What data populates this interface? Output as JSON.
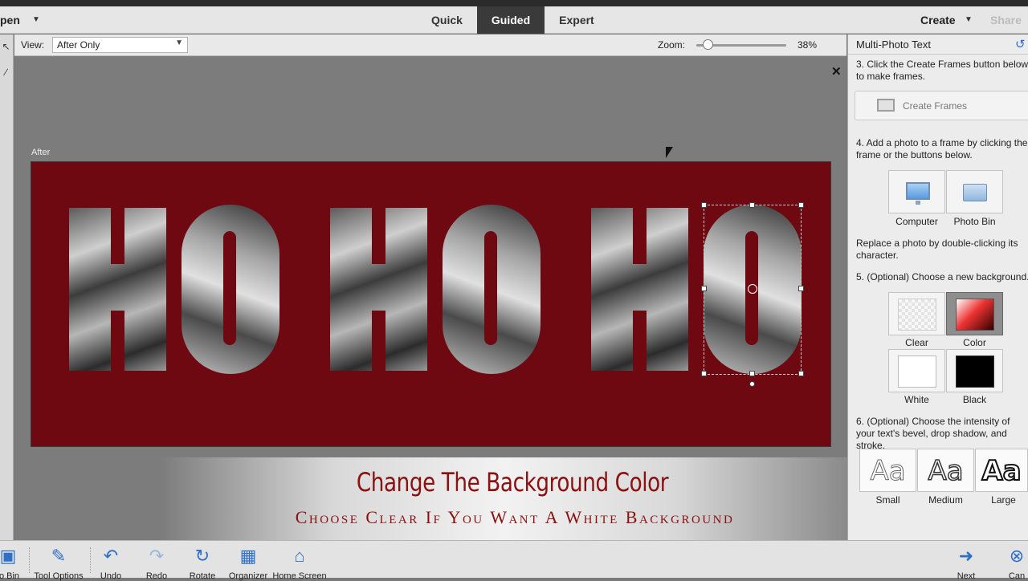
{
  "menubar": {
    "open_label": "pen",
    "modes": [
      "Quick",
      "Guided",
      "Expert"
    ],
    "active_mode": "Guided",
    "create_label": "Create",
    "share_label": "Share"
  },
  "options": {
    "view_label": "View:",
    "view_value": "After Only",
    "zoom_label": "Zoom:",
    "zoom_value": "38%",
    "zoom_level_pct": 38
  },
  "canvas": {
    "after_label": "After",
    "text_art": "HO HO HO",
    "background_color": "#6e0912"
  },
  "banner": {
    "title": "Change The Background Color",
    "subtitle": "Choose Clear If You Want A White Background"
  },
  "panel": {
    "title": "Multi-Photo Text",
    "step3": "3. Click the Create Frames button below to make frames.",
    "create_frames_label": "Create Frames",
    "step4": "4. Add a photo to a frame by clicking the frame or the buttons below.",
    "source_tiles": [
      "Computer",
      "Photo Bin"
    ],
    "replace_note": "Replace a photo by double-clicking its character.",
    "step5": "5. (Optional) Choose a new background.",
    "backgrounds": [
      "Clear",
      "Color",
      "White",
      "Black"
    ],
    "selected_background": "Color",
    "step6": "6. (Optional) Choose the intensity of your text's bevel, drop shadow, and stroke.",
    "intensity_glyph": "Aa",
    "intensities": [
      "Small",
      "Medium",
      "Large"
    ]
  },
  "bottombar": {
    "buttons": [
      "to Bin",
      "Tool Options",
      "Undo",
      "Redo",
      "Rotate",
      "Organizer",
      "Home Screen"
    ],
    "next_label": "Next",
    "cancel_label": "Can"
  },
  "colors": {
    "accent": "#2f6fc6",
    "banner_text": "#8b1010",
    "active_mode_bg": "#3a3a3a"
  }
}
